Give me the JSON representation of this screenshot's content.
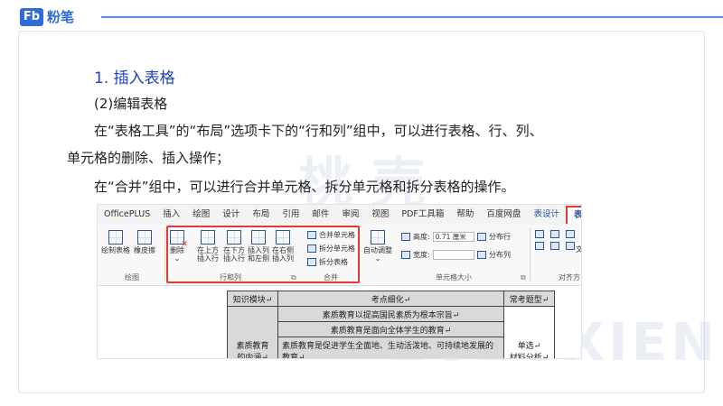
{
  "brand": {
    "mark": "Fb",
    "name": "粉笔",
    "accent": "#2f6bd9"
  },
  "watermark": {
    "line1": "桃 壳",
    "line2": "ZUZUXIENBI"
  },
  "content": {
    "title": "1.  插入表格",
    "subtitle": "(2)编辑表格",
    "para1_line1": "在“表格工具”的“布局”选项卡下的“行和列”组中，可以进行表格、行、列、",
    "para1_line2": "单元格的删除、插入操作；",
    "para2": "在“合并”组中，可以进行合并单元格、拆分单元格和拆分表格的操作。"
  },
  "ribbon": {
    "tabs": [
      "OfficePLUS",
      "插入",
      "绘图",
      "设计",
      "布局",
      "引用",
      "邮件",
      "审阅",
      "视图",
      "PDF工具箱",
      "帮助",
      "百度网盘",
      "表设计",
      "表布局"
    ],
    "active_tab": "表布局",
    "draw_group": {
      "label": "绘图",
      "draw_table": "绘制表格",
      "eraser": "橡皮擦"
    },
    "rows_cols_group": {
      "label": "行和列",
      "delete": "删除",
      "insert_above": "在上方\n插入行",
      "insert_below": "在下方\n插入行",
      "insert_left": "插入列\n和左侧",
      "insert_right": "在右侧\n插入列"
    },
    "merge_group": {
      "label": "合并",
      "merge_cells": "合并单元格",
      "split_cells": "拆分单元格",
      "split_table": "拆分表格"
    },
    "cell_size_group": {
      "label": "单元格大小",
      "autofit": "自动调整",
      "height_label": "高度:",
      "height_value": "0.71 厘米",
      "width_label": "宽度:",
      "width_value": "",
      "distribute_rows": "分布行",
      "distribute_cols": "分布列"
    },
    "align_group": {
      "label": "对齐方",
      "text_direction": "文"
    }
  },
  "doc_table": {
    "headers": [
      "知识模块↵",
      "考点细化↵",
      "常考题型↵"
    ],
    "rows": [
      "素质教育以提高国民素质为根本宗旨↵",
      "素质教育是面向全体学生的教育↵",
      "素质教育是促进学生全面地、生动活泼地、可持续地发展的教育↵"
    ],
    "left_cell": "素质教育",
    "left_cell_line2": "的内涵↵",
    "right_cell": "单选↵",
    "right_cell_line2": "材料分析↵"
  }
}
